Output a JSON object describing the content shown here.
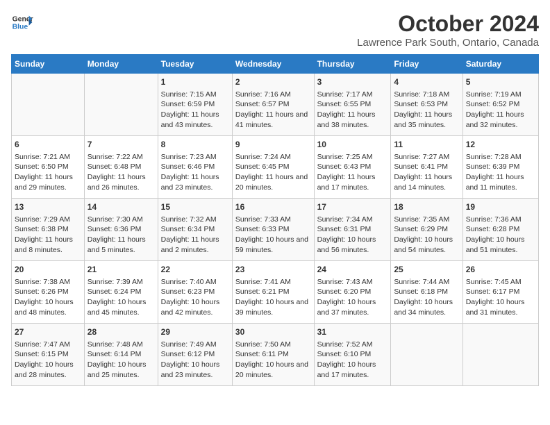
{
  "header": {
    "logo_line1": "General",
    "logo_line2": "Blue",
    "title": "October 2024",
    "subtitle": "Lawrence Park South, Ontario, Canada"
  },
  "columns": [
    "Sunday",
    "Monday",
    "Tuesday",
    "Wednesday",
    "Thursday",
    "Friday",
    "Saturday"
  ],
  "weeks": [
    [
      {
        "day": "",
        "content": ""
      },
      {
        "day": "",
        "content": ""
      },
      {
        "day": "1",
        "content": "Sunrise: 7:15 AM\nSunset: 6:59 PM\nDaylight: 11 hours and 43 minutes."
      },
      {
        "day": "2",
        "content": "Sunrise: 7:16 AM\nSunset: 6:57 PM\nDaylight: 11 hours and 41 minutes."
      },
      {
        "day": "3",
        "content": "Sunrise: 7:17 AM\nSunset: 6:55 PM\nDaylight: 11 hours and 38 minutes."
      },
      {
        "day": "4",
        "content": "Sunrise: 7:18 AM\nSunset: 6:53 PM\nDaylight: 11 hours and 35 minutes."
      },
      {
        "day": "5",
        "content": "Sunrise: 7:19 AM\nSunset: 6:52 PM\nDaylight: 11 hours and 32 minutes."
      }
    ],
    [
      {
        "day": "6",
        "content": "Sunrise: 7:21 AM\nSunset: 6:50 PM\nDaylight: 11 hours and 29 minutes."
      },
      {
        "day": "7",
        "content": "Sunrise: 7:22 AM\nSunset: 6:48 PM\nDaylight: 11 hours and 26 minutes."
      },
      {
        "day": "8",
        "content": "Sunrise: 7:23 AM\nSunset: 6:46 PM\nDaylight: 11 hours and 23 minutes."
      },
      {
        "day": "9",
        "content": "Sunrise: 7:24 AM\nSunset: 6:45 PM\nDaylight: 11 hours and 20 minutes."
      },
      {
        "day": "10",
        "content": "Sunrise: 7:25 AM\nSunset: 6:43 PM\nDaylight: 11 hours and 17 minutes."
      },
      {
        "day": "11",
        "content": "Sunrise: 7:27 AM\nSunset: 6:41 PM\nDaylight: 11 hours and 14 minutes."
      },
      {
        "day": "12",
        "content": "Sunrise: 7:28 AM\nSunset: 6:39 PM\nDaylight: 11 hours and 11 minutes."
      }
    ],
    [
      {
        "day": "13",
        "content": "Sunrise: 7:29 AM\nSunset: 6:38 PM\nDaylight: 11 hours and 8 minutes."
      },
      {
        "day": "14",
        "content": "Sunrise: 7:30 AM\nSunset: 6:36 PM\nDaylight: 11 hours and 5 minutes."
      },
      {
        "day": "15",
        "content": "Sunrise: 7:32 AM\nSunset: 6:34 PM\nDaylight: 11 hours and 2 minutes."
      },
      {
        "day": "16",
        "content": "Sunrise: 7:33 AM\nSunset: 6:33 PM\nDaylight: 10 hours and 59 minutes."
      },
      {
        "day": "17",
        "content": "Sunrise: 7:34 AM\nSunset: 6:31 PM\nDaylight: 10 hours and 56 minutes."
      },
      {
        "day": "18",
        "content": "Sunrise: 7:35 AM\nSunset: 6:29 PM\nDaylight: 10 hours and 54 minutes."
      },
      {
        "day": "19",
        "content": "Sunrise: 7:36 AM\nSunset: 6:28 PM\nDaylight: 10 hours and 51 minutes."
      }
    ],
    [
      {
        "day": "20",
        "content": "Sunrise: 7:38 AM\nSunset: 6:26 PM\nDaylight: 10 hours and 48 minutes."
      },
      {
        "day": "21",
        "content": "Sunrise: 7:39 AM\nSunset: 6:24 PM\nDaylight: 10 hours and 45 minutes."
      },
      {
        "day": "22",
        "content": "Sunrise: 7:40 AM\nSunset: 6:23 PM\nDaylight: 10 hours and 42 minutes."
      },
      {
        "day": "23",
        "content": "Sunrise: 7:41 AM\nSunset: 6:21 PM\nDaylight: 10 hours and 39 minutes."
      },
      {
        "day": "24",
        "content": "Sunrise: 7:43 AM\nSunset: 6:20 PM\nDaylight: 10 hours and 37 minutes."
      },
      {
        "day": "25",
        "content": "Sunrise: 7:44 AM\nSunset: 6:18 PM\nDaylight: 10 hours and 34 minutes."
      },
      {
        "day": "26",
        "content": "Sunrise: 7:45 AM\nSunset: 6:17 PM\nDaylight: 10 hours and 31 minutes."
      }
    ],
    [
      {
        "day": "27",
        "content": "Sunrise: 7:47 AM\nSunset: 6:15 PM\nDaylight: 10 hours and 28 minutes."
      },
      {
        "day": "28",
        "content": "Sunrise: 7:48 AM\nSunset: 6:14 PM\nDaylight: 10 hours and 25 minutes."
      },
      {
        "day": "29",
        "content": "Sunrise: 7:49 AM\nSunset: 6:12 PM\nDaylight: 10 hours and 23 minutes."
      },
      {
        "day": "30",
        "content": "Sunrise: 7:50 AM\nSunset: 6:11 PM\nDaylight: 10 hours and 20 minutes."
      },
      {
        "day": "31",
        "content": "Sunrise: 7:52 AM\nSunset: 6:10 PM\nDaylight: 10 hours and 17 minutes."
      },
      {
        "day": "",
        "content": ""
      },
      {
        "day": "",
        "content": ""
      }
    ]
  ]
}
